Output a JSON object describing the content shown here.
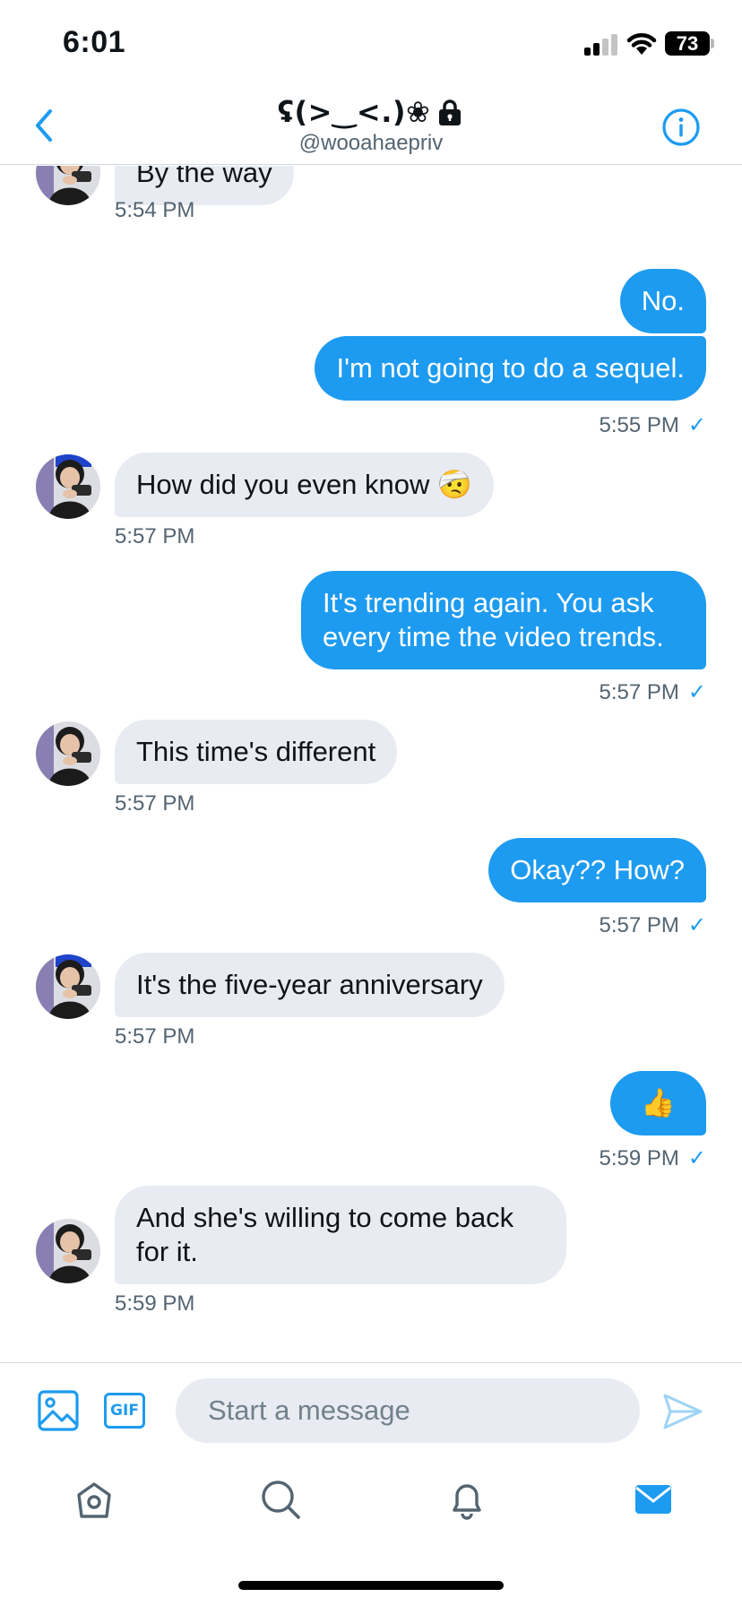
{
  "status_bar": {
    "time": "6:01",
    "battery": "73"
  },
  "header": {
    "title": "ʢ(>‿<.)❀",
    "handle": "@wooahaepriv",
    "back_icon": "chevron-left-icon",
    "info_icon": "info-icon",
    "lock_icon": "lock-icon"
  },
  "messages": [
    {
      "direction": "in",
      "text": "By the way",
      "time": "5:54 PM"
    },
    {
      "direction": "out",
      "text": "No.",
      "time": ""
    },
    {
      "direction": "out",
      "text": "I'm not going to do a sequel.",
      "time": "5:55 PM",
      "read": true
    },
    {
      "direction": "in",
      "text": "How did you even know 🤕",
      "time": "5:57 PM"
    },
    {
      "direction": "out",
      "text": "It's trending again. You ask every time the video trends.",
      "time": "5:57 PM",
      "read": true
    },
    {
      "direction": "in",
      "text": "This time's different",
      "time": "5:57 PM"
    },
    {
      "direction": "out",
      "text": "Okay?? How?",
      "time": "5:57 PM",
      "read": true
    },
    {
      "direction": "in",
      "text": "It's the five-year anniversary",
      "time": "5:57 PM"
    },
    {
      "direction": "out",
      "text": "👍",
      "time": "5:59 PM",
      "read": true
    },
    {
      "direction": "in",
      "text": "And she's willing to come back for it.",
      "time": "5:59 PM"
    }
  ],
  "composer": {
    "placeholder": "Start a message",
    "gif_label": "GIF"
  },
  "nav": [
    "home-icon",
    "search-icon",
    "notifications-icon",
    "messages-icon"
  ],
  "colors": {
    "accent": "#1d9bf0",
    "incoming_bubble": "#e8ebf1",
    "muted_text": "#536471"
  }
}
